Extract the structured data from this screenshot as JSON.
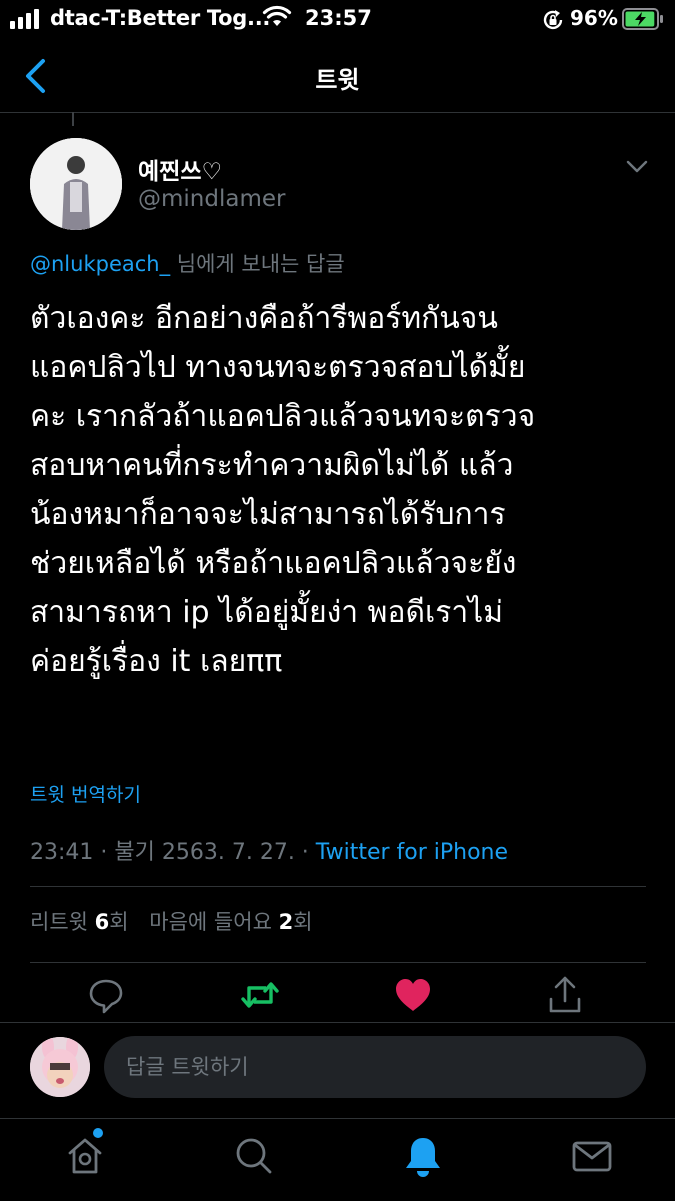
{
  "status_bar": {
    "carrier": "dtac-T:Better Tog...",
    "time": "23:57",
    "battery_percent": "96%",
    "battery_level": 0.96,
    "icons": [
      "signal-icon",
      "wifi-icon",
      "orientation-lock-icon",
      "battery-charging-icon"
    ]
  },
  "nav": {
    "title": "트윗",
    "back_icon": "chevron-left-icon"
  },
  "tweet": {
    "display_name": "예찐쓰♡",
    "handle": "@mindlamer",
    "reply_to_handle": "@nlukpeach_",
    "reply_to_suffix": " 님에게 보내는 답글",
    "text_lines": [
      "ตัวเองคะ อีกอย่างคือถ้ารีพอร์ทกันจน",
      "แอคปลิวไป ทางจนทจะตรวจสอบได้มั้ย",
      "คะ เรากลัวถ้าแอคปลิวแล้วจนทจะตรวจ",
      "สอบหาคนที่กระทำความผิดไม่ได้ แล้ว",
      "น้องหมาก็อาจจะไม่สามารถได้รับการ",
      "ช่วยเหลือได้ หรือถ้าแอคปลิวแล้วจะยัง",
      "สามารถหา ip ได้อยู่มั้ยง่า พอดีเราไม่",
      "ค่อยรู้เรื่อง it เลยππ"
    ],
    "translate_label": "트윗 번역하기",
    "time": "23:41",
    "date": "불기 2563. 7. 27.",
    "separator": " · ",
    "source": "Twitter for iPhone",
    "retweets_label": "리트윗",
    "retweets_count": "6",
    "likes_label": "마음에 들어요",
    "likes_count": "2",
    "count_suffix": "회"
  },
  "actions": {
    "reply_icon": "reply-icon",
    "retweet_icon": "retweet-icon",
    "like_icon": "heart-icon",
    "share_icon": "share-icon",
    "retweeted": true,
    "liked": true
  },
  "compose": {
    "placeholder": "답글 트윗하기"
  },
  "tabbar": {
    "items": [
      "home-icon",
      "search-icon",
      "notifications-icon",
      "messages-icon"
    ],
    "active": "notifications-icon"
  },
  "colors": {
    "accent": "#1da1f2",
    "retweet_green": "#17bf63",
    "like_red": "#e0245e",
    "muted": "#6e767d",
    "background": "#000000",
    "divider": "#2f3336"
  }
}
